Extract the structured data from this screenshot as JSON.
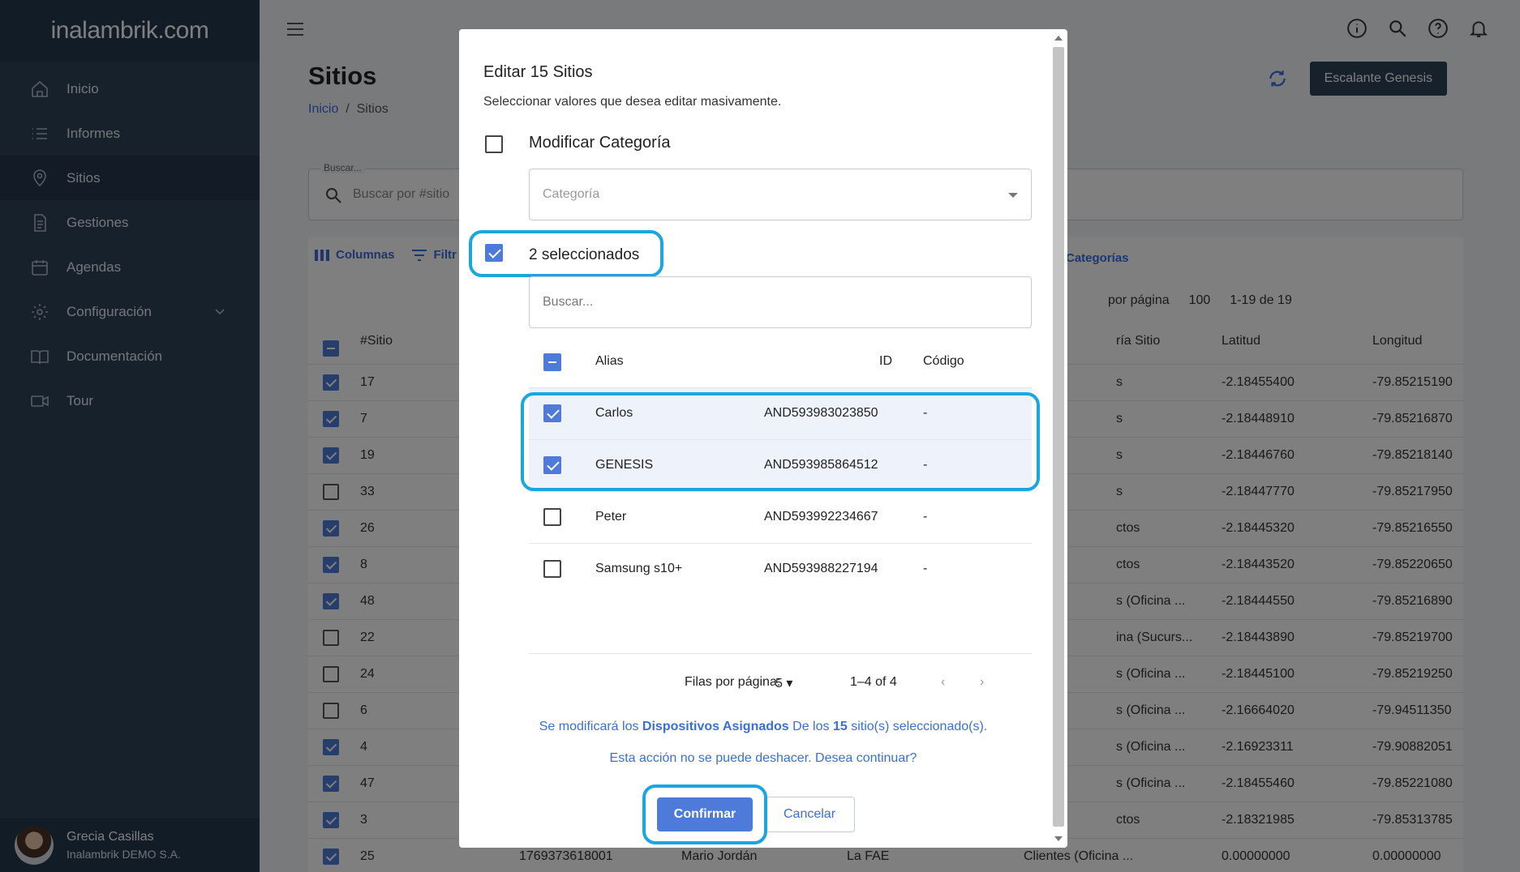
{
  "sidebar": {
    "brand": "inalambrik.com",
    "items": [
      {
        "label": "Inicio",
        "icon": "home-icon"
      },
      {
        "label": "Informes",
        "icon": "list-icon"
      },
      {
        "label": "Sitios",
        "icon": "location-pin-icon",
        "active": true
      },
      {
        "label": "Gestiones",
        "icon": "document-icon"
      },
      {
        "label": "Agendas",
        "icon": "calendar-icon"
      },
      {
        "label": "Configuración",
        "icon": "gear-icon"
      },
      {
        "label": "Documentación",
        "icon": "book-icon"
      },
      {
        "label": "Tour",
        "icon": "video-icon"
      }
    ],
    "user": {
      "name": "Grecia Casillas",
      "org": "Inalambrik DEMO S.A."
    }
  },
  "header": {
    "title": "Sitios",
    "breadcrumb": [
      "Inicio",
      "Sitios"
    ],
    "primary_button": "Escalante Genesis"
  },
  "search": {
    "label": "Buscar...",
    "placeholder": "Buscar por #sitio"
  },
  "table": {
    "tools": [
      "Columnas",
      "Filtr"
    ],
    "categories_link": "Categorías",
    "rows_per_page_label": "por página",
    "rows_per_page": "100",
    "range": "1-19 de 19",
    "headers": {
      "sitio": "#Sitio",
      "categoria": "ría Sitio",
      "lat": "Latitud",
      "lon": "Longitud"
    },
    "rows": [
      {
        "id": "17",
        "checked": true,
        "cat": "s",
        "lat": "-2.18455400",
        "lon": "-79.85215190"
      },
      {
        "id": "7",
        "checked": true,
        "cat": "s",
        "lat": "-2.18448910",
        "lon": "-79.85216870"
      },
      {
        "id": "19",
        "checked": true,
        "cat": "s",
        "lat": "-2.18446760",
        "lon": "-79.85218140"
      },
      {
        "id": "33",
        "checked": false,
        "cat": "s",
        "lat": "-2.18447770",
        "lon": "-79.85217950"
      },
      {
        "id": "26",
        "checked": true,
        "cat": "ctos",
        "lat": "-2.18445320",
        "lon": "-79.85216550"
      },
      {
        "id": "8",
        "checked": true,
        "cat": "ctos",
        "lat": "-2.18443520",
        "lon": "-79.85220650"
      },
      {
        "id": "48",
        "checked": true,
        "cat": "s (Oficina ...",
        "lat": "-2.18444550",
        "lon": "-79.85216890"
      },
      {
        "id": "22",
        "checked": false,
        "cat": "ina (Sucurs...",
        "lat": "-2.18443890",
        "lon": "-79.85219700"
      },
      {
        "id": "24",
        "checked": false,
        "cat": "s (Oficina ...",
        "lat": "-2.18445100",
        "lon": "-79.85219250"
      },
      {
        "id": "6",
        "checked": false,
        "cat": "s (Oficina ...",
        "lat": "-2.16664020",
        "lon": "-79.94511350"
      },
      {
        "id": "4",
        "checked": true,
        "cat": "s (Oficina ...",
        "lat": "-2.16923311",
        "lon": "-79.90882051"
      },
      {
        "id": "47",
        "checked": true,
        "cat": "s (Oficina ...",
        "lat": "-2.18455460",
        "lon": "-79.85221080"
      },
      {
        "id": "3",
        "checked": true,
        "cat": "ctos",
        "lat": "-2.18321985",
        "lon": "-79.85313785"
      },
      {
        "id": "25",
        "checked": true,
        "ruc": "1769373618001",
        "name": "Mario Jordán",
        "zone": "La FAE",
        "cat": "Clientes (Oficina ...",
        "lat": "0.00000000",
        "lon": "0.00000000"
      }
    ]
  },
  "modal": {
    "title": "Editar 15 Sitios",
    "subtitle": "Seleccionar valores que desea editar masivamente.",
    "modify_category_label": "Modificar Categoría",
    "category_placeholder": "Categoría",
    "selected_label": "2 seleccionados",
    "inner_search_placeholder": "Buscar...",
    "grid_headers": {
      "alias": "Alias",
      "id": "ID",
      "code": "Código"
    },
    "devices": [
      {
        "alias": "Carlos",
        "id": "AND593983023850",
        "code": "-",
        "checked": true
      },
      {
        "alias": "GENESIS",
        "id": "AND593985864512",
        "code": "-",
        "checked": true
      },
      {
        "alias": "Peter",
        "id": "AND593992234667",
        "code": "-",
        "checked": false
      },
      {
        "alias": "Samsung s10+",
        "id": "AND593988227194",
        "code": "-",
        "checked": false
      }
    ],
    "footer": {
      "rows_label": "Filas por página:",
      "rows_value": "5",
      "range": "1–4 of 4"
    },
    "note": {
      "prefix": "Se modificará los ",
      "bold1": "Dispositivos Asignados",
      "middle": " De los ",
      "bold2": "15",
      "suffix": " sitio(s) seleccionado(s)."
    },
    "warning": "Esta acción no se puede deshacer. Desea continuar?",
    "confirm_label": "Confirmar",
    "cancel_label": "Cancelar"
  },
  "colors": {
    "sidebar": "#2e4258",
    "accent": "#4e7ad9",
    "highlight": "#1aa6e0"
  }
}
